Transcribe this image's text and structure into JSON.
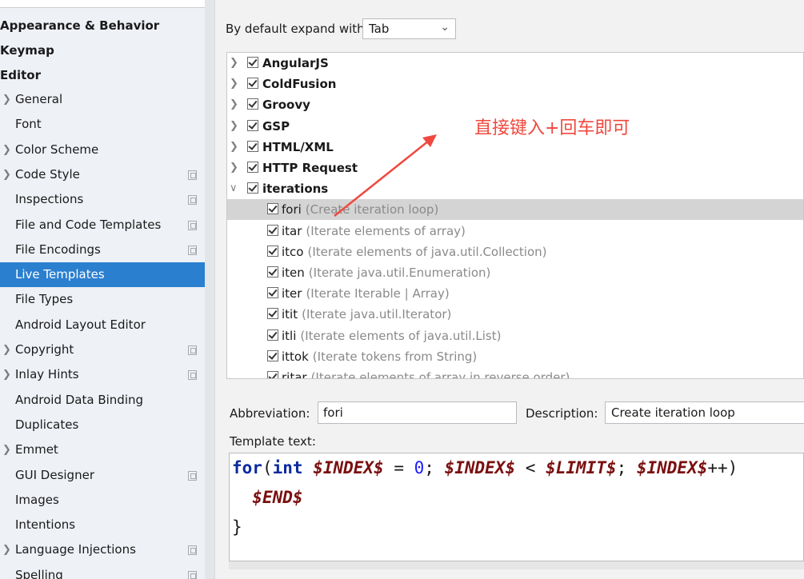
{
  "sidebar": {
    "top_items": [
      "Appearance & Behavior",
      "Keymap",
      "Editor"
    ],
    "items": [
      {
        "label": "General",
        "arrow": true,
        "copy": false,
        "selected": false
      },
      {
        "label": "Font",
        "arrow": false,
        "copy": false,
        "selected": false
      },
      {
        "label": "Color Scheme",
        "arrow": true,
        "copy": false,
        "selected": false
      },
      {
        "label": "Code Style",
        "arrow": true,
        "copy": true,
        "selected": false
      },
      {
        "label": "Inspections",
        "arrow": false,
        "copy": true,
        "selected": false
      },
      {
        "label": "File and Code Templates",
        "arrow": false,
        "copy": true,
        "selected": false
      },
      {
        "label": "File Encodings",
        "arrow": false,
        "copy": true,
        "selected": false
      },
      {
        "label": "Live Templates",
        "arrow": false,
        "copy": false,
        "selected": true
      },
      {
        "label": "File Types",
        "arrow": false,
        "copy": false,
        "selected": false
      },
      {
        "label": "Android Layout Editor",
        "arrow": false,
        "copy": false,
        "selected": false
      },
      {
        "label": "Copyright",
        "arrow": true,
        "copy": true,
        "selected": false
      },
      {
        "label": "Inlay Hints",
        "arrow": true,
        "copy": true,
        "selected": false
      },
      {
        "label": "Android Data Binding",
        "arrow": false,
        "copy": false,
        "selected": false
      },
      {
        "label": "Duplicates",
        "arrow": false,
        "copy": false,
        "selected": false
      },
      {
        "label": "Emmet",
        "arrow": true,
        "copy": false,
        "selected": false
      },
      {
        "label": "GUI Designer",
        "arrow": false,
        "copy": true,
        "selected": false
      },
      {
        "label": "Images",
        "arrow": false,
        "copy": false,
        "selected": false
      },
      {
        "label": "Intentions",
        "arrow": false,
        "copy": false,
        "selected": false
      },
      {
        "label": "Language Injections",
        "arrow": true,
        "copy": true,
        "selected": false
      },
      {
        "label": "Spelling",
        "arrow": false,
        "copy": true,
        "selected": false
      }
    ],
    "icons": {
      "collapsed": "chevron-right-icon",
      "copy": "copy-settings-icon"
    }
  },
  "expand": {
    "label": "By default expand with",
    "value": "Tab"
  },
  "tree": {
    "groups": [
      "AngularJS",
      "ColdFusion",
      "Groovy",
      "GSP",
      "HTML/XML",
      "HTTP Request"
    ],
    "expanded_group": "iterations",
    "children": [
      {
        "abbr": "fori",
        "desc": "(Create iteration loop)",
        "selected": true
      },
      {
        "abbr": "itar",
        "desc": "(Iterate elements of array)",
        "selected": false
      },
      {
        "abbr": "itco",
        "desc": "(Iterate elements of java.util.Collection)",
        "selected": false
      },
      {
        "abbr": "iten",
        "desc": "(Iterate java.util.Enumeration)",
        "selected": false
      },
      {
        "abbr": "iter",
        "desc": "(Iterate Iterable | Array)",
        "selected": false
      },
      {
        "abbr": "itit",
        "desc": "(Iterate java.util.Iterator)",
        "selected": false
      },
      {
        "abbr": "itli",
        "desc": "(Iterate elements of java.util.List)",
        "selected": false
      },
      {
        "abbr": "ittok",
        "desc": "(Iterate tokens from String)",
        "selected": false
      },
      {
        "abbr": "ritar",
        "desc": "(Iterate elements of array in reverse order)",
        "selected": false
      }
    ]
  },
  "fields": {
    "abbreviation_label": "Abbreviation:",
    "abbreviation_value": "fori",
    "description_label": "Description:",
    "description_value": "Create iteration loop",
    "template_label": "Template text:"
  },
  "template": {
    "line1": [
      {
        "t": "for",
        "c": "kw"
      },
      {
        "t": "(",
        "c": ""
      },
      {
        "t": "int",
        "c": "kw"
      },
      {
        "t": " ",
        "c": ""
      },
      {
        "t": "$INDEX$",
        "c": "var"
      },
      {
        "t": " = ",
        "c": ""
      },
      {
        "t": "0",
        "c": "num"
      },
      {
        "t": "; ",
        "c": ""
      },
      {
        "t": "$INDEX$",
        "c": "var"
      },
      {
        "t": " < ",
        "c": ""
      },
      {
        "t": "$LIMIT$",
        "c": "var"
      },
      {
        "t": "; ",
        "c": ""
      },
      {
        "t": "$INDEX$",
        "c": "var"
      },
      {
        "t": "++)",
        "c": ""
      }
    ],
    "line2": [
      {
        "t": "  ",
        "c": ""
      },
      {
        "t": "$END$",
        "c": "var"
      }
    ],
    "line3": [
      {
        "t": "}",
        "c": ""
      }
    ]
  },
  "annotation": {
    "text": "直接键入+回车即可",
    "color": "#f0483e"
  },
  "colors": {
    "selected": "#2b7fcf",
    "keyword": "#0a2a9c",
    "variable": "#7a0f0f",
    "number": "#1b1bff"
  }
}
